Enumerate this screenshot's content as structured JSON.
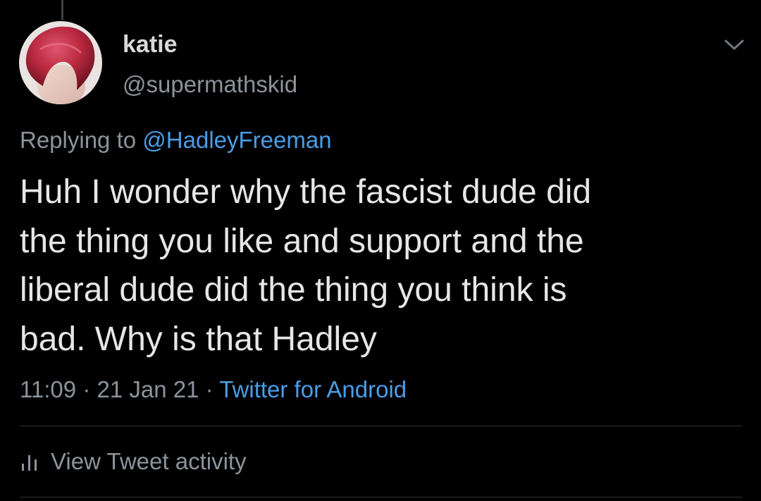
{
  "tweet": {
    "author": {
      "display_name": "katie",
      "handle": "@supermathskid",
      "avatar_icon": "profile-photo"
    },
    "replying_to": {
      "prefix": "Replying to",
      "mention": "@HadleyFreeman"
    },
    "text_lines": [
      "Huh I wonder why the fascist dude did",
      "the thing you like and support and the",
      "liberal dude did the thing you think is",
      "bad. Why is that Hadley"
    ],
    "time": "11:09",
    "separator": "·",
    "date": "21 Jan 21",
    "source": "Twitter for Android",
    "activity_label": "View Tweet activity",
    "activity_icon": "bar-chart-icon",
    "more_icon": "chevron-down-icon"
  },
  "colors": {
    "background": "#000000",
    "text_primary": "#e6e6e6",
    "text_secondary": "#8b939b",
    "link": "#4a9de6",
    "divider": "#2f3336"
  }
}
